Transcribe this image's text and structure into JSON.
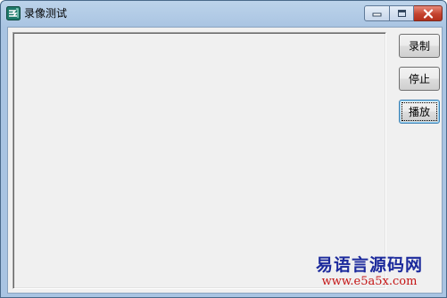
{
  "window": {
    "title": "录像测试",
    "icon": "app-logo-icon"
  },
  "caption_buttons": {
    "minimize_icon": "minimize-icon",
    "maximize_icon": "maximize-icon",
    "close_icon": "close-icon"
  },
  "buttons": {
    "record_label": "录制",
    "stop_label": "停止",
    "play_label": "播放"
  },
  "watermark": {
    "line1": "易语言源码网",
    "line2": "www.e5a5x.com"
  },
  "colors": {
    "titlebar": "#a9c4e2",
    "client_bg": "#f0f0f0",
    "close_button": "#c4432f",
    "watermark_blue": "#1c2a9c",
    "watermark_red": "#c41414"
  }
}
